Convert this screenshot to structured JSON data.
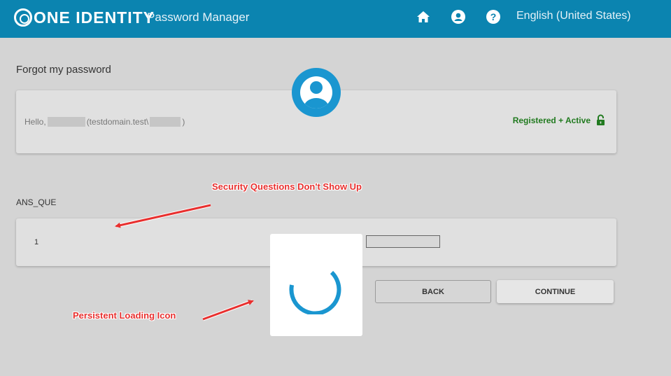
{
  "header": {
    "brand": "ONE IDENTITY",
    "app_name": "Password Manager",
    "language": "English (United States)",
    "icons": [
      "home-icon",
      "user-icon",
      "help-icon"
    ]
  },
  "page": {
    "title": "Forgot my password"
  },
  "user_card": {
    "hello": "Hello,",
    "domain": "(testdomain.test\\",
    "close_paren": ")",
    "status": "Registered + Active",
    "status_color": "#217a1f"
  },
  "questions": {
    "section_label": "ANS_QUE",
    "items": [
      {
        "number": "1",
        "answer": ""
      }
    ]
  },
  "buttons": {
    "back": "BACK",
    "continue": "CONTINUE"
  },
  "annotations": {
    "questions_missing": "Security Questions Don't Show Up",
    "loading": "Persistent Loading Icon",
    "color": "#e8302f"
  },
  "colors": {
    "header_bg": "#0b84b0",
    "accent": "#1a96d0",
    "page_bg": "#d4d4d4"
  }
}
